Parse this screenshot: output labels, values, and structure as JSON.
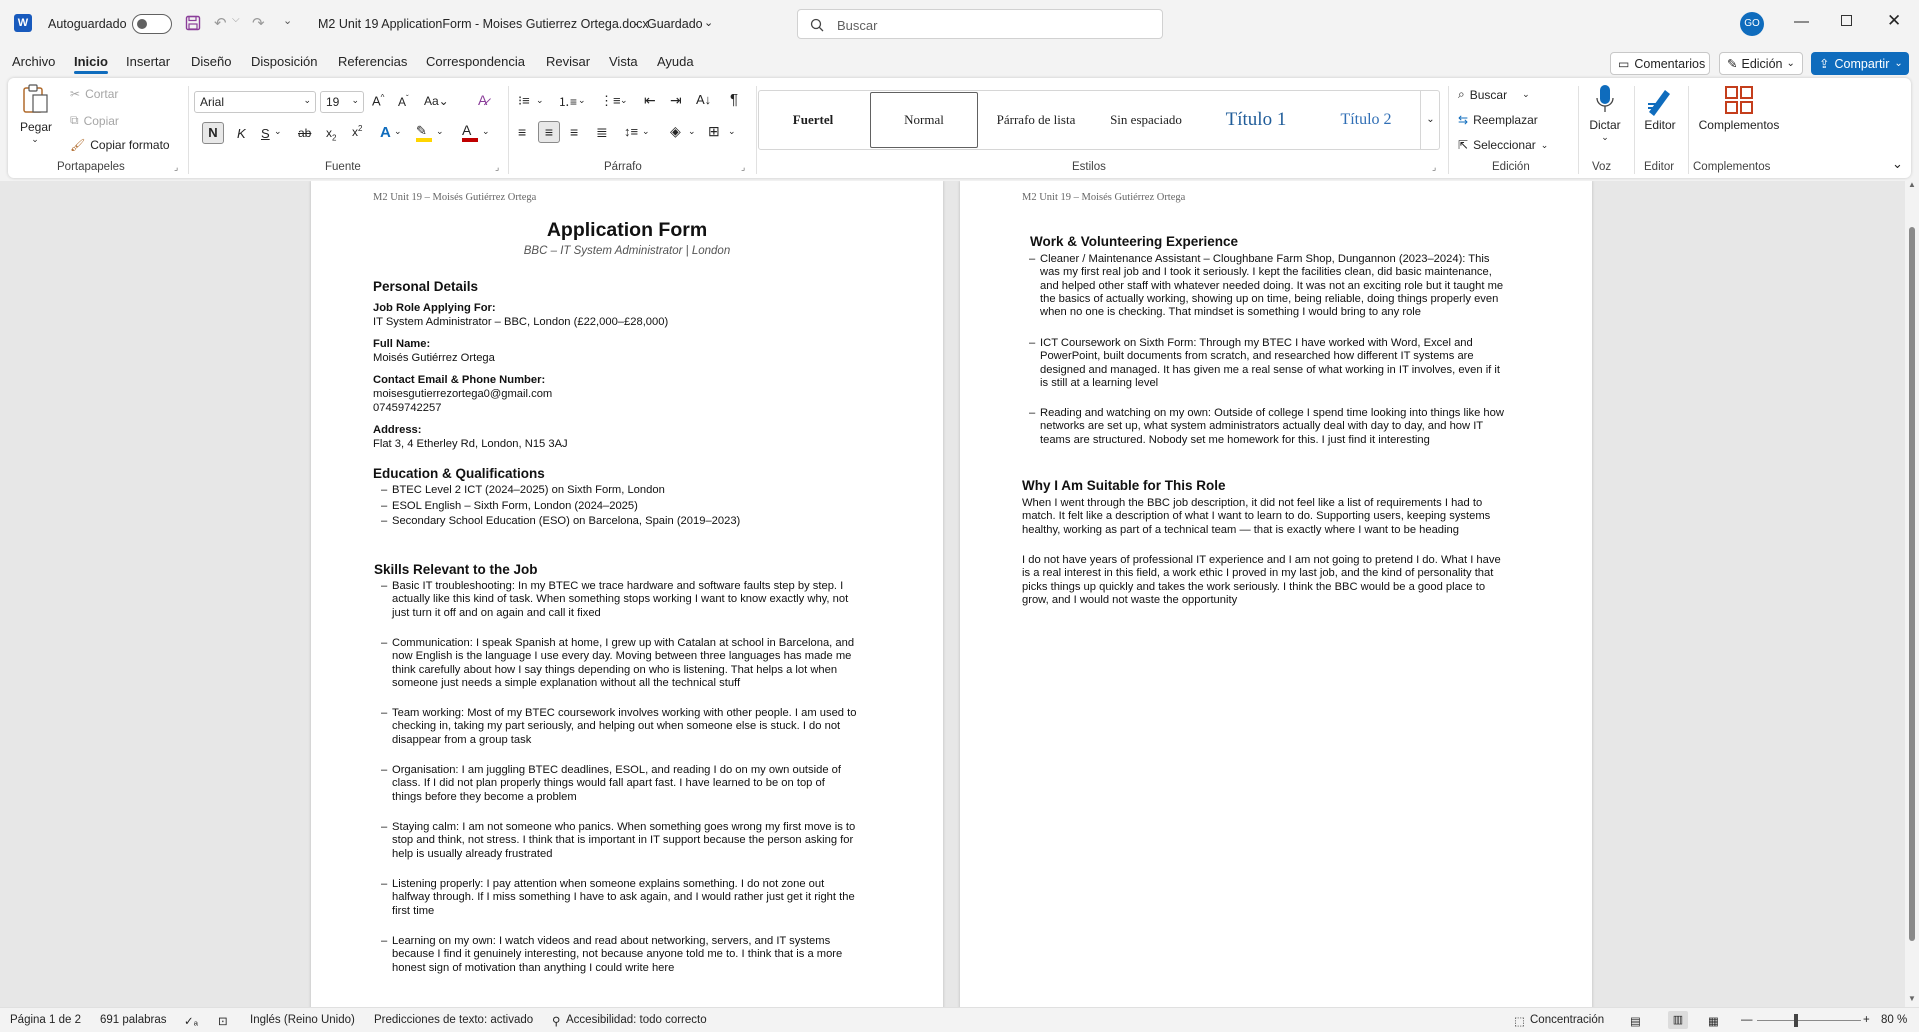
{
  "titlebar": {
    "autosave_label": "Autoguardado",
    "document_title": "M2 Unit 19 ApplicationForm - Moises Gutierrez Ortega.docx",
    "save_state": "Guardado",
    "search_placeholder": "Buscar",
    "avatar_initials": "GO"
  },
  "menu": {
    "tabs": [
      "Archivo",
      "Inicio",
      "Insertar",
      "Diseño",
      "Disposición",
      "Referencias",
      "Correspondencia",
      "Revisar",
      "Vista",
      "Ayuda"
    ],
    "active_tab": "Inicio",
    "comments": "Comentarios",
    "editing": "Edición",
    "share": "Compartir"
  },
  "ribbon": {
    "clipboard": {
      "paste": "Pegar",
      "cut": "Cortar",
      "copy": "Copiar",
      "format_painter": "Copiar formato",
      "label": "Portapapeles"
    },
    "font": {
      "family": "Arial",
      "size": "19",
      "label": "Fuente",
      "bold": "N",
      "italic": "K",
      "underline": "S"
    },
    "paragraph": {
      "label": "Párrafo"
    },
    "styles": {
      "items": [
        "Fuertel",
        "Normal",
        "Párrafo de lista",
        "Sin espaciado",
        "Título 1",
        "Título 2"
      ],
      "label": "Estilos"
    },
    "editing": {
      "find": "Buscar",
      "replace": "Reemplazar",
      "select": "Seleccionar",
      "label": "Edición"
    },
    "voice": {
      "dictate": "Dictar",
      "label": "Voz"
    },
    "editor": {
      "btn": "Editor",
      "label": "Editor"
    },
    "addins": {
      "btn": "Complementos",
      "label": "Complementos"
    }
  },
  "doc": {
    "header": "M2 Unit 19 – Moisés Gutiérrez Ortega",
    "title": "Application Form",
    "subtitle": "BBC – IT System Administrator | London",
    "personal_heading": "Personal Details",
    "job_label": "Job Role Applying For:",
    "job_value": "IT System Administrator – BBC, London (£22,000–£28,000)",
    "name_label": "Full Name:",
    "name_value": "Moisés Gutiérrez Ortega",
    "contact_label": "Contact Email & Phone Number:",
    "email": "moisesgutierrezortega0@gmail.com",
    "phone": "07459742257",
    "address_label": "Address:",
    "address_value": "Flat 3, 4 Etherley Rd, London, N15 3AJ",
    "education_heading": "Education & Qualifications",
    "education": [
      "BTEC Level 2 ICT (2024–2025) on Sixth Form, London",
      "ESOL English – Sixth Form, London (2024–2025)",
      "Secondary School Education (ESO) on Barcelona, Spain (2019–2023)"
    ],
    "skills_heading": "Skills Relevant to the Job",
    "skills": [
      "Basic IT troubleshooting: In my BTEC we trace hardware and software faults step by step. I\nactually like this kind of task. When something stops working I want to know exactly why, not\njust turn it off and on again and call it fixed",
      "Communication: I speak Spanish at home, I grew up with Catalan at school in Barcelona, and\nnow English is the language I use every day. Moving between three languages has made me\nthink carefully about how I say things depending on who is listening. That helps a lot when\nsomeone just needs a simple explanation without all the technical stuff",
      "Team working: Most of my BTEC coursework involves working with other people. I am used to\nchecking in, taking my part seriously, and helping out when someone else is stuck. I do not\ndisappear from a group task",
      "Organisation: I am juggling BTEC deadlines, ESOL, and reading I do on my own outside of\nclass. If I did not plan properly things would fall apart fast. I have learned to be on top of\nthings before they become a problem",
      "Staying calm: I am not someone who panics. When something goes wrong my first move is to\nstop and think, not stress. I think that is important in IT support because the person asking for\nhelp is usually already frustrated",
      "Listening properly: I pay attention when someone explains something. I do not zone out\nhalfway through. If I miss something I have to ask again, and I would rather just get it right the\nfirst time",
      "Learning on my own: I watch videos and read about networking, servers, and IT systems\nbecause I find it genuinely interesting, not because anyone told me to. I think that is a more\nhonest sign of motivation than anything I could write here"
    ],
    "work_heading": "Work & Volunteering Experience",
    "work": [
      "Cleaner / Maintenance Assistant – Cloughbane Farm Shop, Dungannon (2023–2024): This\nwas my first real job and I took it seriously. I kept the facilities clean, did basic maintenance,\nand helped other staff with whatever needed doing. It was not an exciting role but it taught me\nthe basics of actually working, showing up on time, being reliable, doing things properly even\nwhen no one is checking. That mindset is something I would bring to any role",
      "ICT Coursework on Sixth Form: Through my BTEC I have worked with Word, Excel and\nPowerPoint, built documents from scratch, and researched how different IT systems are\ndesigned and managed. It has given me a real sense of what working in IT involves, even if it\nis still at a learning level",
      "Reading and watching on my own: Outside of college I spend time looking into things like how\nnetworks are set up, what system administrators actually deal with day to day, and how IT\nteams are structured. Nobody set me homework for this. I just find it interesting"
    ],
    "suitable_heading": "Why I Am Suitable for This Role",
    "suitable_p1": "When I went through the BBC job description, it did not feel like a list of requirements I had to\nmatch. It felt like a description of what I want to learn to do. Supporting users, keeping systems\nhealthy, working as part of a technical team — that is exactly where I want to be heading",
    "suitable_p2": "I do not have years of professional IT experience and I am not going to pretend I do. What I have\nis a real interest in this field, a work ethic I proved in my last job, and the kind of personality that\npicks things up quickly and takes the work seriously. I think the BBC would be a good place to\ngrow, and I would not waste the opportunity"
  },
  "status": {
    "page": "Página 1 de 2",
    "words": "691 palabras",
    "language": "Inglés (Reino Unido)",
    "predictions": "Predicciones de texto: activado",
    "accessibility": "Accesibilidad: todo correcto",
    "focus": "Concentración",
    "zoom": "80 %"
  },
  "colors": {
    "accent": "#0f6cbd",
    "word_blue": "#185abd"
  }
}
